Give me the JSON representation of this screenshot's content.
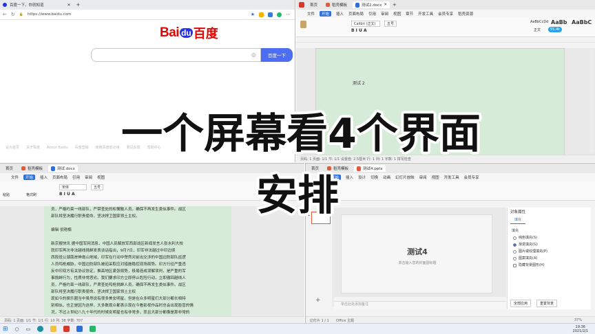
{
  "overlay": {
    "line1": "一个屏幕看4个界面",
    "line2": "安排"
  },
  "browser": {
    "tab_title": "百度一下，你就知道",
    "url": "https://www.baidu.com",
    "logo_bai": "Bai",
    "logo_du": "du",
    "logo_cn": "百度",
    "search_button": "百度一下",
    "footer_links": [
      "设为首页",
      "关于百度",
      "About Baidu",
      "百度营销",
      "使用百度前必读",
      "意见反馈",
      "帮助中心"
    ]
  },
  "word_top": {
    "tab_home": "首页",
    "tab_template": "稻壳模板",
    "tab_doc": "测试2.docx",
    "menu": [
      "文件",
      "开始",
      "插入",
      "页面布局",
      "引用",
      "审阅",
      "视图",
      "章节",
      "开发工具",
      "会员专享",
      "稻壳资源"
    ],
    "active_menu": "开始",
    "font_name": "Calibri (正文)",
    "font_size": "五号",
    "style_samples": [
      "AaBbCcDd",
      "AaBb",
      "AaBbC"
    ],
    "style_label": "正文",
    "badge": "55.4k",
    "body_text": "测试 2",
    "status": "页码: 1  页面: 1/1  节: 1/1  设置值: 2.5厘米  行: 1  列: 1  字数: 1  拼写检查"
  },
  "word_bottom": {
    "tab_home": "首页",
    "tab_template": "稻壳模板",
    "tab_doc": "测试.docx",
    "menu": [
      "文件",
      "开始",
      "插入",
      "页面布局",
      "引用",
      "审阅",
      "视图"
    ],
    "active_menu": "开始",
    "font_name": "宋体",
    "font_size": "五号",
    "side_labels": [
      "粘贴",
      "格式刷"
    ],
    "paragraphs": [
      "员，严格约束一线部队，严禁查处的松懈散人员，确保不再发生类似事件。战区",
      "部队将坚决履行职责使命，坚决捍卫国家领土主权。",
      "",
      "编辑  倪艳楠",
      "",
      "新京报快讯  据中国军网消息，中国人民解放军西部战区新闻发言人张水利大校",
      "就印军再次非法越线挑衅发表谈话指出，9月7日，印军非法越过中印边境",
      "西段班公湖南岸神炮山地域，印军在行动中悍然对前出交涉的中国边防部队巡逻",
      "人员鸣枪威胁，中国边防部队被迫采取应对措施稳控现场局势。印方行径严重违",
      "反中印双方有关协议协定，推高地区紧张局势，极易造成误解误判，是严重的军",
      "事挑衅行为，性质非常恶劣。我们要求印方立即停止危险行动，立即撤回越线人",
      "员，严格约束一线部队，严肃查处鸣枪挑衅人员，确保不再发生类似事件。战区",
      "部队将坚决履行职责使命，坚决捍卫国家领土主权",
      "现如今的娱乐圈当中虽然说有很多美女明星，但是在众多明星们大部分都长相特",
      "别相似，也正是因为这样，大多数观众都表示现在今看影视作品时总会出现脸盲的情",
      "况，不过上世纪八九十年代的时候女明星也有非常多，而且大部分都像是那非常的"
    ],
    "status": "页码: 1  页面: 1/1  节: 1/1  行: 10  列: 38  字数: 707"
  },
  "ppt": {
    "tab_home": "首页",
    "tab_template": "稻壳模板",
    "tab_doc": "测试4.pptx",
    "menu": [
      "文件",
      "开始",
      "插入",
      "设计",
      "切换",
      "动画",
      "幻灯片放映",
      "审阅",
      "视图",
      "开发工具",
      "会员专享"
    ],
    "active_menu": "开始",
    "thumb_number": "1",
    "slide_title": "测试4",
    "slide_subtitle": "单击输入您的封面副标题",
    "notes_placeholder": "单击此处添加备注",
    "panel_title": "对象属性",
    "panel_tab": "填充",
    "panel_section": "填充",
    "fill_options": [
      "纯色填充(S)",
      "渐变填充(G)",
      "图片或纹理填充(P)",
      "图案填充(A)",
      "隐藏背景图形(H)"
    ],
    "fill_selected": 1,
    "panel_button": "全部应用",
    "panel_reset": "重置背景",
    "status_slide": "幻灯片 1 / 1",
    "status_theme": "Office 主题",
    "zoom": "37%"
  },
  "taskbar": {
    "time": "19:36",
    "date": "2021/2/1"
  },
  "colors": {
    "accent": "#2f6fd8",
    "wps_red": "#d33a2c",
    "green_page": "#d6ecd8",
    "baidu_blue": "#2932e1",
    "baidu_red": "#e10602"
  }
}
